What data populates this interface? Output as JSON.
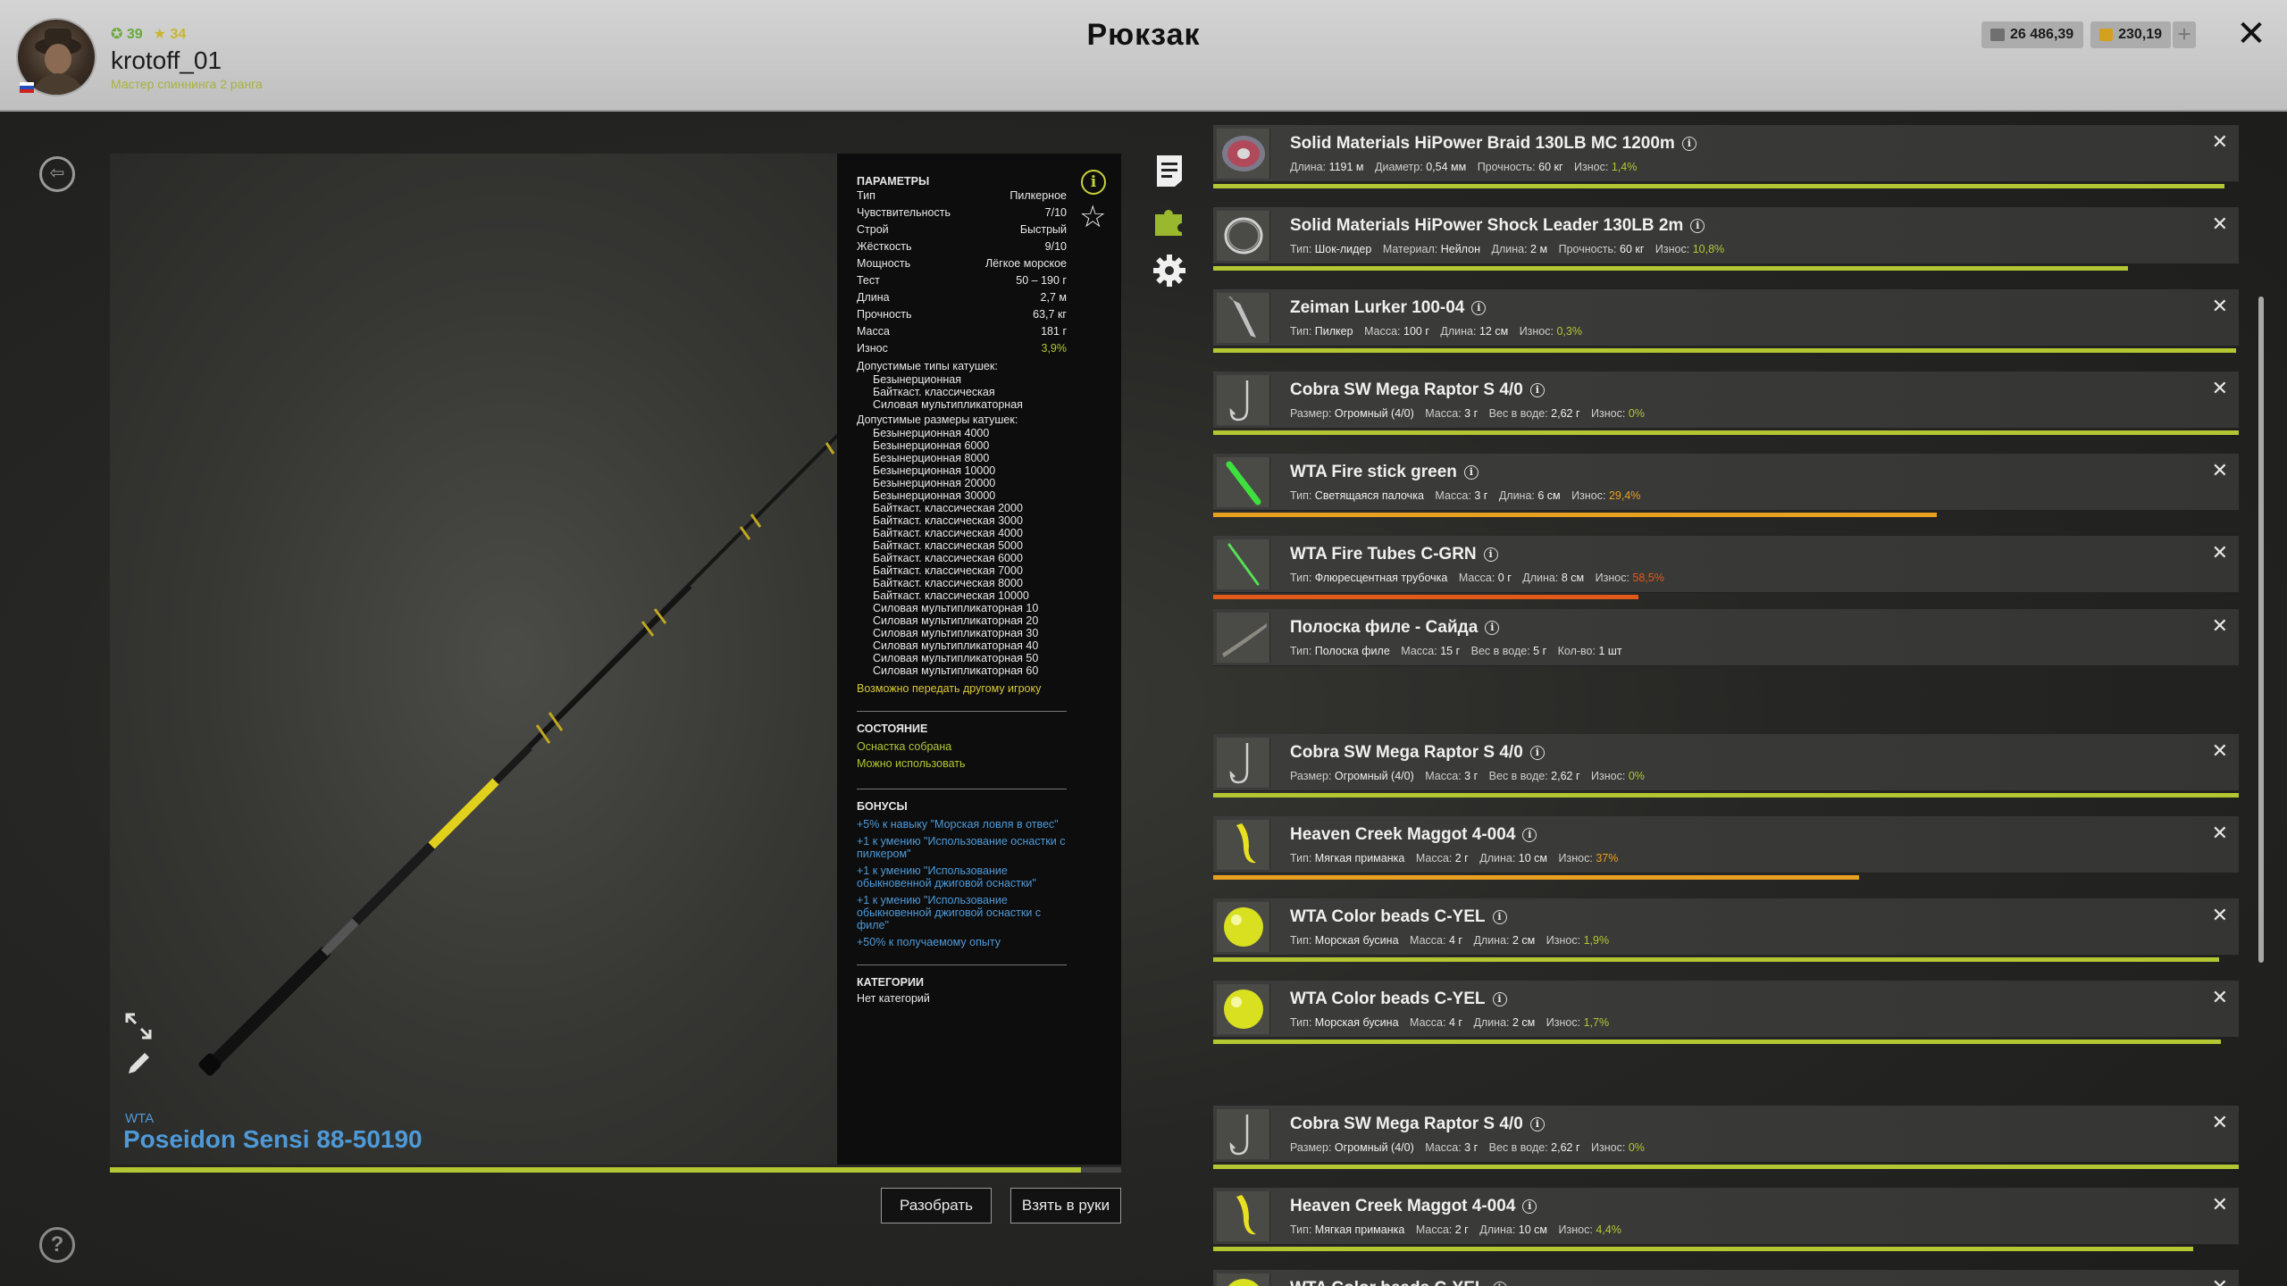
{
  "header": {
    "title": "Рюкзак",
    "level": "39",
    "stars": "34",
    "username": "krotoff_01",
    "rank": "Мастер спиннинга 2 ранга",
    "silver": "26 486,39",
    "gold": "230,19",
    "plus": "+",
    "close": "✕"
  },
  "item": {
    "brand": "WTA",
    "name": "Poseidon Sensi 88-50190",
    "durability_fraction": 0.96
  },
  "params": {
    "title": "Параметры",
    "rows": [
      {
        "k": "Тип",
        "v": "Пилкерное"
      },
      {
        "k": "Чувствительность",
        "v": "7/10"
      },
      {
        "k": "Строй",
        "v": "Быстрый"
      },
      {
        "k": "Жёсткость",
        "v": "9/10"
      },
      {
        "k": "Мощность",
        "v": "Лёгкое морское"
      },
      {
        "k": "Тест",
        "v": "50 – 190 г"
      },
      {
        "k": "Длина",
        "v": "2,7 м"
      },
      {
        "k": "Прочность",
        "v": "63,7 кг"
      },
      {
        "k": "Масса",
        "v": "181 г"
      },
      {
        "k": "Износ",
        "v": "3,9%"
      }
    ],
    "reel_types_title": "Допустимые типы катушек:",
    "reel_types": [
      "Безынерционная",
      "Байткаст. классическая",
      "Силовая мультипликаторная"
    ],
    "reel_sizes_title": "Допустимые размеры катушек:",
    "reel_sizes": [
      "Безынерционная 4000",
      "Безынерционная 6000",
      "Безынерционная 8000",
      "Безынерционная 10000",
      "Безынерционная 20000",
      "Безынерционная 30000",
      "Байткаст. классическая 2000",
      "Байткаст. классическая 3000",
      "Байткаст. классическая 4000",
      "Байткаст. классическая 5000",
      "Байткаст. классическая 6000",
      "Байткаст. классическая 7000",
      "Байткаст. классическая 8000",
      "Байткаст. классическая 10000",
      "Силовая мультипликаторная 10",
      "Силовая мультипликаторная 20",
      "Силовая мультипликаторная 30",
      "Силовая мультипликаторная 40",
      "Силовая мультипликаторная 50",
      "Силовая мультипликаторная 60"
    ],
    "transfer": "Возможно передать другому игроку",
    "state_title": "Состояние",
    "state": [
      "Оснастка собрана",
      "Можно использовать"
    ],
    "bonus_title": "Бонусы",
    "bonuses": [
      "+5% к навыку \"Морская ловля в отвес\"",
      "+1 к умению \"Использование оснастки с пилкером\"",
      "+1 к умению \"Использование обыкновенной джиговой оснастки\"",
      "+1 к умению \"Использование обыкновенной джиговой оснастки с филе\"",
      "+50% к получаемому опыту"
    ],
    "cat_title": "Категории",
    "cat_value": "Нет категорий"
  },
  "actions": {
    "disassemble": "Разобрать",
    "take": "Взять в руки"
  },
  "colors": {
    "accent_green": "#b3c733",
    "wear_orange": "#e8a020",
    "wear_red": "#e05a1a",
    "link_blue": "#4e9ad8",
    "link_yellow": "#d8c93a"
  },
  "inventory": [
    {
      "icon": "line-spool-icon",
      "name": "Solid Materials HiPower Braid 130LB MC 1200m",
      "desc": [
        [
          "",
          "Длина:",
          "1191 м"
        ],
        [
          "",
          "Диаметр:",
          "0,54 мм"
        ],
        [
          "",
          "Прочность:",
          "60 кг"
        ]
      ],
      "wear_label": "Износ:",
      "wear": "1,4%",
      "wear_fraction": 0.986,
      "bar_color": "#b3c733"
    },
    {
      "icon": "leader-coil-icon",
      "name": "Solid Materials HiPower Shock Leader 130LB 2m",
      "desc": [
        [
          "",
          "Тип:",
          "Шок-лидер"
        ],
        [
          "",
          "Материал:",
          "Нейлон"
        ],
        [
          "",
          "Длина:",
          "2 м"
        ],
        [
          "",
          "Прочность:",
          "60 кг"
        ]
      ],
      "wear_label": "Износ:",
      "wear": "10,8%",
      "wear_fraction": 0.892,
      "bar_color": "#b3c733"
    },
    {
      "icon": "pilker-icon",
      "name": "Zeiman Lurker 100-04",
      "desc": [
        [
          "",
          "Тип:",
          "Пилкер"
        ],
        [
          "",
          "Масса:",
          "100 г"
        ],
        [
          "",
          "Длина:",
          "12 см"
        ]
      ],
      "wear_label": "Износ:",
      "wear": "0,3%",
      "wear_fraction": 0.997,
      "bar_color": "#b3c733"
    },
    {
      "icon": "hook-icon",
      "name": "Cobra SW Mega Raptor S 4/0",
      "desc": [
        [
          "",
          "Размер:",
          "Огромный (4/0)"
        ],
        [
          "",
          "Масса:",
          "3 г"
        ],
        [
          "",
          "Вес в воде:",
          "2,62 г"
        ]
      ],
      "wear_label": "Износ:",
      "wear": "0%",
      "wear_fraction": 1.0,
      "bar_color": "#b3c733"
    },
    {
      "icon": "glow-stick-icon",
      "name": "WTA Fire stick green",
      "desc": [
        [
          "",
          "Тип:",
          "Светящаяся палочка"
        ],
        [
          "",
          "Масса:",
          "3 г"
        ],
        [
          "",
          "Длина:",
          "6 см"
        ]
      ],
      "wear_label": "Износ:",
      "wear": "29,4%",
      "wear_fraction": 0.706,
      "bar_color": "#e8a020"
    },
    {
      "icon": "fluoro-tube-icon",
      "name": "WTA Fire Tubes C-GRN",
      "desc": [
        [
          "",
          "Тип:",
          "Флюресцентная трубочка"
        ],
        [
          "",
          "Масса:",
          "0 г"
        ],
        [
          "",
          "Длина:",
          "8 см"
        ]
      ],
      "wear_label": "Износ:",
      "wear": "58,5%",
      "wear_fraction": 0.415,
      "bar_color": "#e05a1a"
    },
    {
      "icon": "fillet-strip-icon",
      "name": "Полоска филе - Сайда",
      "desc": [
        [
          "",
          "Тип:",
          "Полоска филе"
        ],
        [
          "",
          "Масса:",
          "15 г"
        ],
        [
          "",
          "Вес в воде:",
          "5 г"
        ],
        [
          "",
          "Кол-во:",
          "1 шт"
        ]
      ],
      "wear_label": "",
      "wear": "",
      "wear_fraction": null,
      "bar_color": ""
    },
    {
      "icon": "hook-icon",
      "name": "Cobra SW Mega Raptor S 4/0",
      "desc": [
        [
          "",
          "Размер:",
          "Огромный (4/0)"
        ],
        [
          "",
          "Масса:",
          "3 г"
        ],
        [
          "",
          "Вес в воде:",
          "2,62 г"
        ]
      ],
      "wear_label": "Износ:",
      "wear": "0%",
      "wear_fraction": 1.0,
      "bar_color": "#b3c733"
    },
    {
      "icon": "soft-maggot-icon",
      "name": "Heaven Creek Maggot 4-004",
      "desc": [
        [
          "",
          "Тип:",
          "Мягкая приманка"
        ],
        [
          "",
          "Масса:",
          "2 г"
        ],
        [
          "",
          "Длина:",
          "10 см"
        ]
      ],
      "wear_label": "Износ:",
      "wear": "37%",
      "wear_fraction": 0.63,
      "bar_color": "#e8a020"
    },
    {
      "icon": "bead-icon",
      "name": "WTA Color beads C-YEL",
      "desc": [
        [
          "",
          "Тип:",
          "Морская бусина"
        ],
        [
          "",
          "Масса:",
          "4 г"
        ],
        [
          "",
          "Длина:",
          "2 см"
        ]
      ],
      "wear_label": "Износ:",
      "wear": "1,9%",
      "wear_fraction": 0.981,
      "bar_color": "#b3c733"
    },
    {
      "icon": "bead-icon",
      "name": "WTA Color beads C-YEL",
      "desc": [
        [
          "",
          "Тип:",
          "Морская бусина"
        ],
        [
          "",
          "Масса:",
          "4 г"
        ],
        [
          "",
          "Длина:",
          "2 см"
        ]
      ],
      "wear_label": "Износ:",
      "wear": "1,7%",
      "wear_fraction": 0.983,
      "bar_color": "#b3c733"
    },
    {
      "icon": "hook-icon",
      "name": "Cobra SW Mega Raptor S 4/0",
      "desc": [
        [
          "",
          "Размер:",
          "Огромный (4/0)"
        ],
        [
          "",
          "Масса:",
          "3 г"
        ],
        [
          "",
          "Вес в воде:",
          "2,62 г"
        ]
      ],
      "wear_label": "Износ:",
      "wear": "0%",
      "wear_fraction": 1.0,
      "bar_color": "#b3c733"
    },
    {
      "icon": "soft-maggot-icon",
      "name": "Heaven Creek Maggot 4-004",
      "desc": [
        [
          "",
          "Тип:",
          "Мягкая приманка"
        ],
        [
          "",
          "Масса:",
          "2 г"
        ],
        [
          "",
          "Длина:",
          "10 см"
        ]
      ],
      "wear_label": "Износ:",
      "wear": "4,4%",
      "wear_fraction": 0.956,
      "bar_color": "#b3c733"
    },
    {
      "icon": "bead-icon",
      "name": "WTA Color beads C-YEL",
      "desc": [],
      "wear_label": "",
      "wear": "",
      "wear_fraction": null,
      "bar_color": ""
    }
  ]
}
